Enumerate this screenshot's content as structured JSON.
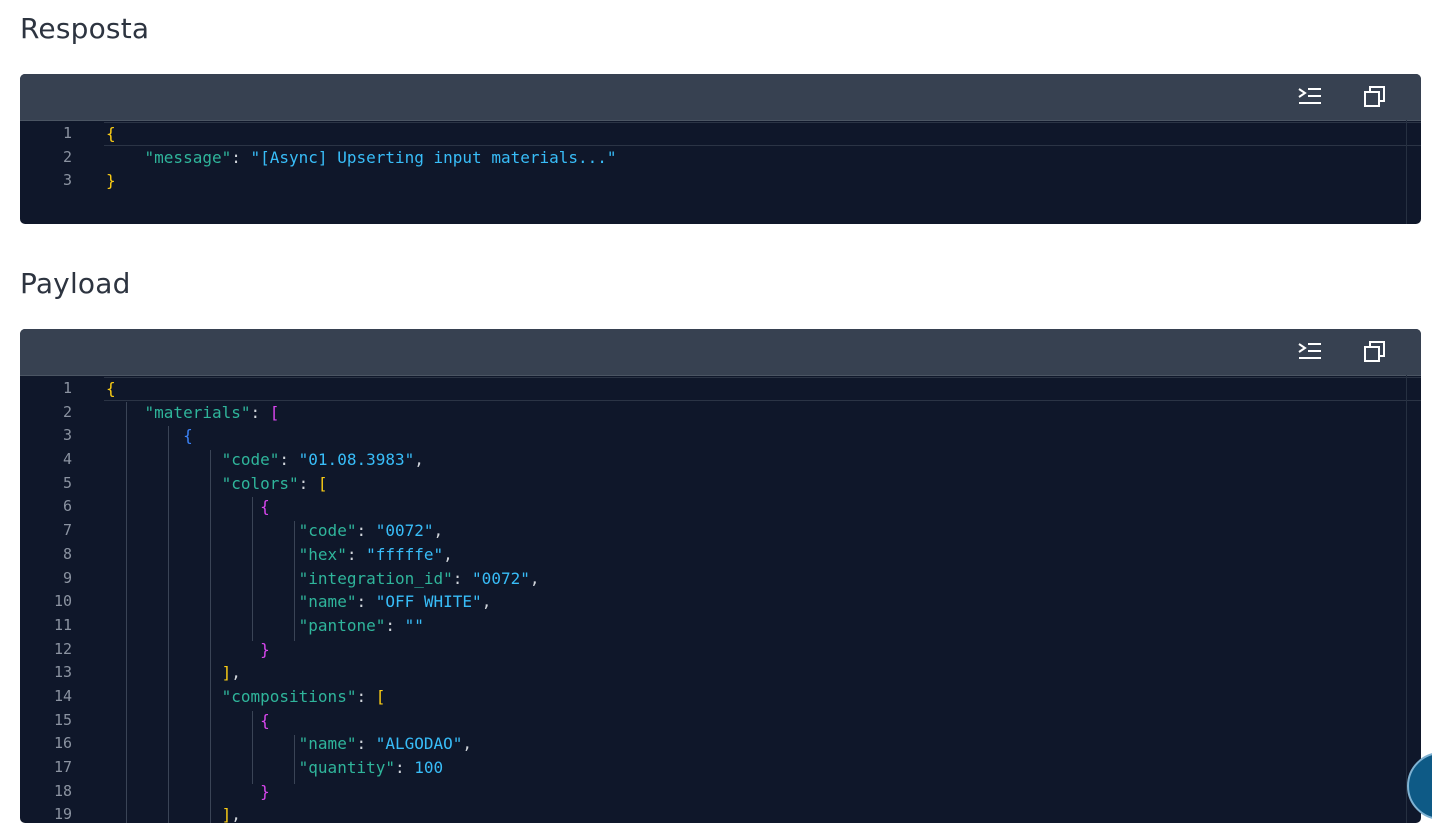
{
  "response": {
    "title": "Resposta",
    "lines": [
      {
        "n": "1",
        "tokens": [
          {
            "t": "{",
            "c": "b1"
          }
        ]
      },
      {
        "n": "2",
        "tokens": [
          {
            "t": "    "
          },
          {
            "t": "\"message\"",
            "c": "k"
          },
          {
            "t": ": ",
            "c": "p"
          },
          {
            "t": "\"[Async] Upserting input materials...\"",
            "c": "s"
          }
        ]
      },
      {
        "n": "3",
        "tokens": [
          {
            "t": "}",
            "c": "b1"
          }
        ]
      }
    ]
  },
  "payload": {
    "title": "Payload",
    "lines": [
      {
        "n": "1",
        "tokens": [
          {
            "t": "{",
            "c": "b1"
          }
        ]
      },
      {
        "n": "2",
        "tokens": [
          {
            "t": "    "
          },
          {
            "t": "\"materials\"",
            "c": "k"
          },
          {
            "t": ": ",
            "c": "p"
          },
          {
            "t": "[",
            "c": "b2"
          }
        ]
      },
      {
        "n": "3",
        "tokens": [
          {
            "t": "        "
          },
          {
            "t": "{",
            "c": "b3"
          }
        ]
      },
      {
        "n": "4",
        "tokens": [
          {
            "t": "            "
          },
          {
            "t": "\"code\"",
            "c": "k"
          },
          {
            "t": ": ",
            "c": "p"
          },
          {
            "t": "\"01.08.3983\"",
            "c": "s"
          },
          {
            "t": ",",
            "c": "p"
          }
        ]
      },
      {
        "n": "5",
        "tokens": [
          {
            "t": "            "
          },
          {
            "t": "\"colors\"",
            "c": "k"
          },
          {
            "t": ": ",
            "c": "p"
          },
          {
            "t": "[",
            "c": "b1"
          }
        ]
      },
      {
        "n": "6",
        "tokens": [
          {
            "t": "                "
          },
          {
            "t": "{",
            "c": "b2"
          }
        ]
      },
      {
        "n": "7",
        "tokens": [
          {
            "t": "                    "
          },
          {
            "t": "\"code\"",
            "c": "k"
          },
          {
            "t": ": ",
            "c": "p"
          },
          {
            "t": "\"0072\"",
            "c": "s"
          },
          {
            "t": ",",
            "c": "p"
          }
        ]
      },
      {
        "n": "8",
        "tokens": [
          {
            "t": "                    "
          },
          {
            "t": "\"hex\"",
            "c": "k"
          },
          {
            "t": ": ",
            "c": "p"
          },
          {
            "t": "\"fffffe\"",
            "c": "s"
          },
          {
            "t": ",",
            "c": "p"
          }
        ]
      },
      {
        "n": "9",
        "tokens": [
          {
            "t": "                    "
          },
          {
            "t": "\"integration_id\"",
            "c": "k"
          },
          {
            "t": ": ",
            "c": "p"
          },
          {
            "t": "\"0072\"",
            "c": "s"
          },
          {
            "t": ",",
            "c": "p"
          }
        ]
      },
      {
        "n": "10",
        "tokens": [
          {
            "t": "                    "
          },
          {
            "t": "\"name\"",
            "c": "k"
          },
          {
            "t": ": ",
            "c": "p"
          },
          {
            "t": "\"OFF WHITE\"",
            "c": "s"
          },
          {
            "t": ",",
            "c": "p"
          }
        ]
      },
      {
        "n": "11",
        "tokens": [
          {
            "t": "                    "
          },
          {
            "t": "\"pantone\"",
            "c": "k"
          },
          {
            "t": ": ",
            "c": "p"
          },
          {
            "t": "\"\"",
            "c": "s"
          }
        ]
      },
      {
        "n": "12",
        "tokens": [
          {
            "t": "                "
          },
          {
            "t": "}",
            "c": "b2"
          }
        ]
      },
      {
        "n": "13",
        "tokens": [
          {
            "t": "            "
          },
          {
            "t": "]",
            "c": "b1"
          },
          {
            "t": ",",
            "c": "p"
          }
        ]
      },
      {
        "n": "14",
        "tokens": [
          {
            "t": "            "
          },
          {
            "t": "\"compositions\"",
            "c": "k"
          },
          {
            "t": ": ",
            "c": "p"
          },
          {
            "t": "[",
            "c": "b1"
          }
        ]
      },
      {
        "n": "15",
        "tokens": [
          {
            "t": "                "
          },
          {
            "t": "{",
            "c": "b2"
          }
        ]
      },
      {
        "n": "16",
        "tokens": [
          {
            "t": "                    "
          },
          {
            "t": "\"name\"",
            "c": "k"
          },
          {
            "t": ": ",
            "c": "p"
          },
          {
            "t": "\"ALGODAO\"",
            "c": "s"
          },
          {
            "t": ",",
            "c": "p"
          }
        ]
      },
      {
        "n": "17",
        "tokens": [
          {
            "t": "                    "
          },
          {
            "t": "\"quantity\"",
            "c": "k"
          },
          {
            "t": ": ",
            "c": "p"
          },
          {
            "t": "100",
            "c": "n"
          }
        ]
      },
      {
        "n": "18",
        "tokens": [
          {
            "t": "                "
          },
          {
            "t": "}",
            "c": "b2"
          }
        ]
      },
      {
        "n": "19",
        "tokens": [
          {
            "t": "            "
          },
          {
            "t": "]",
            "c": "b1"
          },
          {
            "t": ",",
            "c": "p"
          }
        ]
      }
    ]
  },
  "toolbar": {
    "format_icon": "indent-lines-icon",
    "copy_icon": "copy-icon"
  },
  "colors": {
    "editor_bg": "#0f172a",
    "toolbar_bg": "#374151",
    "key": "#2fb59b",
    "string": "#38bdf8"
  }
}
